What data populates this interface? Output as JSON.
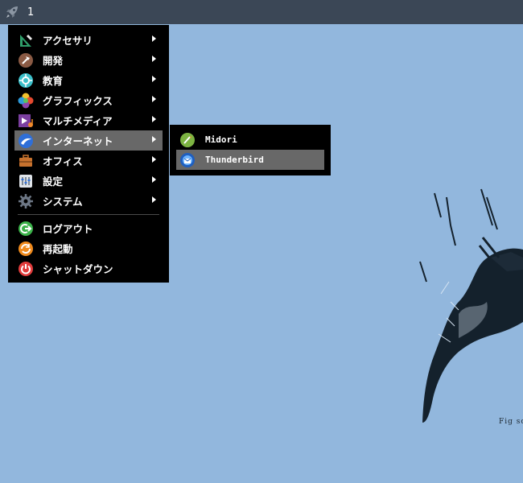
{
  "taskbar": {
    "desktop_number": "1",
    "launcher_icon": "rocket-icon"
  },
  "menu": {
    "items": [
      {
        "label": "アクセサリ",
        "icon": "accessories-icon",
        "submenu": true
      },
      {
        "label": "開発",
        "icon": "development-icon",
        "submenu": true
      },
      {
        "label": "教育",
        "icon": "education-icon",
        "submenu": true
      },
      {
        "label": "グラフィックス",
        "icon": "graphics-icon",
        "submenu": true
      },
      {
        "label": "マルチメディア",
        "icon": "multimedia-icon",
        "submenu": true
      },
      {
        "label": "インターネット",
        "icon": "internet-icon",
        "submenu": true,
        "active": true
      },
      {
        "label": "オフィス",
        "icon": "office-icon",
        "submenu": true
      },
      {
        "label": "設定",
        "icon": "settings-icon",
        "submenu": true
      },
      {
        "label": "システム",
        "icon": "system-icon",
        "submenu": true
      }
    ],
    "actions": [
      {
        "label": "ログアウト",
        "icon": "logout-icon"
      },
      {
        "label": "再起動",
        "icon": "reboot-icon"
      },
      {
        "label": "シャットダウン",
        "icon": "shutdown-icon"
      }
    ]
  },
  "submenu": {
    "items": [
      {
        "label": "Midori",
        "icon": "midori-icon"
      },
      {
        "label": "Thunderbird",
        "icon": "thunderbird-icon",
        "active": true
      }
    ]
  },
  "wallpaper": {
    "caption": "Fig sc"
  },
  "colors": {
    "desktop": "#92b7dd",
    "taskbar": "#3b4756",
    "menu_bg": "#000000",
    "highlight": "#686868",
    "text": "#ffffff"
  }
}
